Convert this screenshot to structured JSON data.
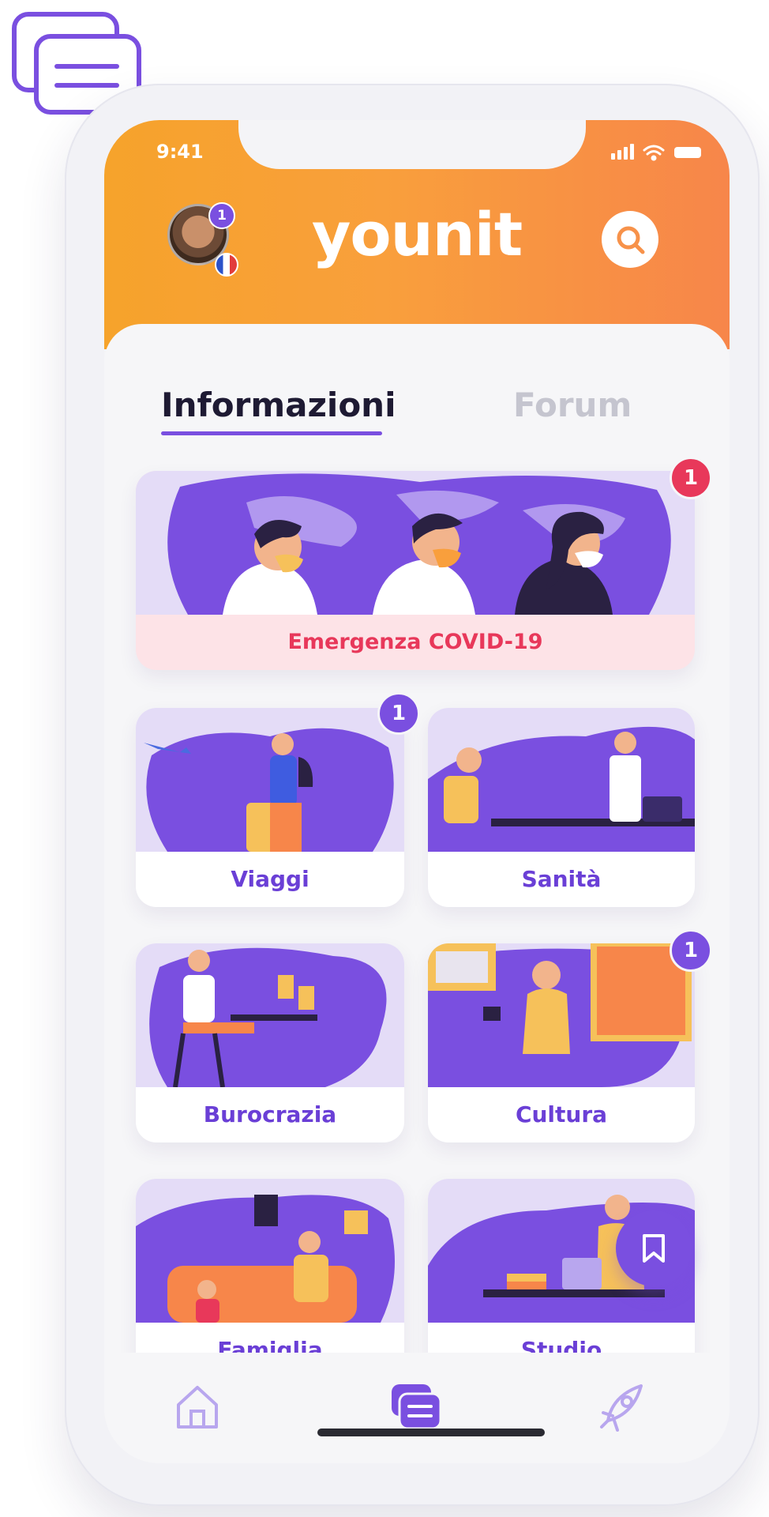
{
  "status_bar": {
    "time": "9:41"
  },
  "header": {
    "brand": "younit",
    "profile_badge": "1"
  },
  "tabs": {
    "active": "Informazioni",
    "inactive": "Forum"
  },
  "banner": {
    "label": "Emergenza COVID-19",
    "badge": "1"
  },
  "categories": [
    {
      "label": "Viaggi",
      "badge": "1"
    },
    {
      "label": "Sanità"
    },
    {
      "label": "Burocrazia"
    },
    {
      "label": "Cultura",
      "badge": "1"
    },
    {
      "label": "Famiglia"
    },
    {
      "label": "Studio"
    }
  ],
  "bottom_nav": {
    "items": [
      {
        "icon": "home-icon",
        "state": "inactive"
      },
      {
        "icon": "news-icon",
        "state": "active"
      },
      {
        "icon": "rocket-icon",
        "state": "inactive"
      }
    ]
  },
  "colors": {
    "brand_orange": "#f99f3c",
    "accent_purple": "#7a4fe0",
    "covid_red": "#e8385a",
    "covid_bg": "#fde3e7"
  }
}
